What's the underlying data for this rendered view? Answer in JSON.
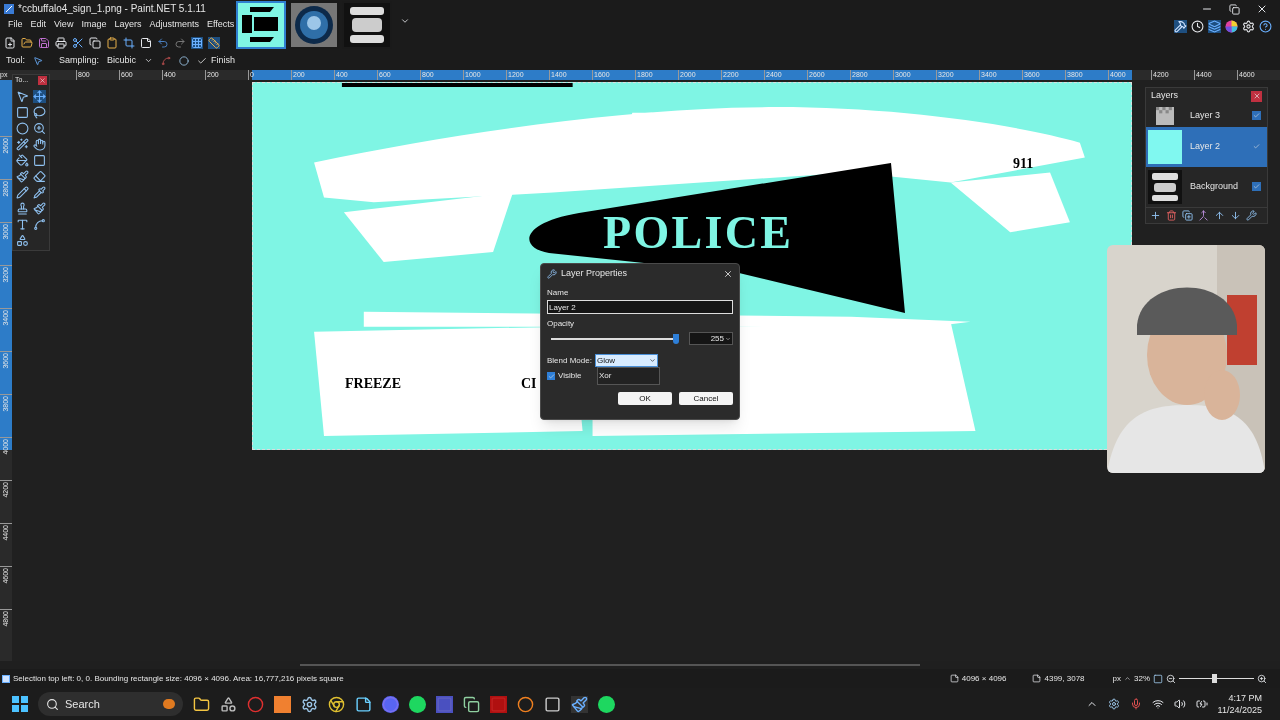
{
  "window": {
    "title": "*ccbuffalo4_sign_1.png - Paint.NET 5.1.11"
  },
  "menu": [
    "File",
    "Edit",
    "View",
    "Image",
    "Layers",
    "Adjustments",
    "Effects"
  ],
  "image_tabs": [
    {
      "selected": true
    },
    {
      "selected": false
    },
    {
      "selected": false
    }
  ],
  "tool_options": {
    "tool_label": "Tool:",
    "sampling_label": "Sampling:",
    "sampling_value": "Bicubic",
    "finish": "Finish"
  },
  "top_ruler": [
    "800",
    "600",
    "400",
    "200",
    "0",
    "200",
    "400",
    "600",
    "800",
    "1000",
    "1200",
    "1400",
    "1600",
    "1800",
    "2000",
    "2200",
    "2400",
    "2600",
    "2800",
    "3000",
    "3200",
    "3400",
    "3600",
    "3800",
    "4000",
    "4200",
    "4400",
    "4600"
  ],
  "ruler_unit": "px",
  "left_ruler": [
    "2600",
    "2800",
    "3000",
    "3200",
    "3400",
    "3600",
    "3800",
    "4000",
    "4200",
    "4400",
    "4600",
    "4800"
  ],
  "tools_panel": {
    "title": "To..."
  },
  "canvas": {
    "banner_text": "POLICE",
    "number_text": "911",
    "left_text": "FREEZE",
    "cut_text": "CI"
  },
  "layers_panel": {
    "title": "Layers",
    "layers": [
      {
        "name": "Layer 3",
        "selected": false,
        "visible": true
      },
      {
        "name": "Layer 2",
        "selected": true,
        "visible": true
      },
      {
        "name": "Background",
        "selected": false,
        "visible": true
      }
    ]
  },
  "dialog": {
    "title": "Layer Properties",
    "name_label": "Name",
    "name_value": "Layer 2",
    "opacity_label": "Opacity",
    "opacity": {
      "level": 0.98
    },
    "opacity_value": "255",
    "blend_label": "Blend Mode:",
    "blend_value": "Glow",
    "blend_options": [
      "Xor"
    ],
    "visible_label": "Visible",
    "visible": true,
    "ok": "OK",
    "cancel": "Cancel"
  },
  "status_bar": {
    "text": "Selection top left: 0, 0. Bounding rectangle size: 4096 × 4096. Area: 16,777,216 pixels square",
    "size": "4096 × 4096",
    "cursor": "4399, 3078",
    "unit": "px",
    "zoom": "32%",
    "zoom_slider": {
      "level": 0.47
    }
  },
  "taskbar": {
    "search": "Search",
    "time": "4:17 PM",
    "date": "11/24/2025"
  }
}
